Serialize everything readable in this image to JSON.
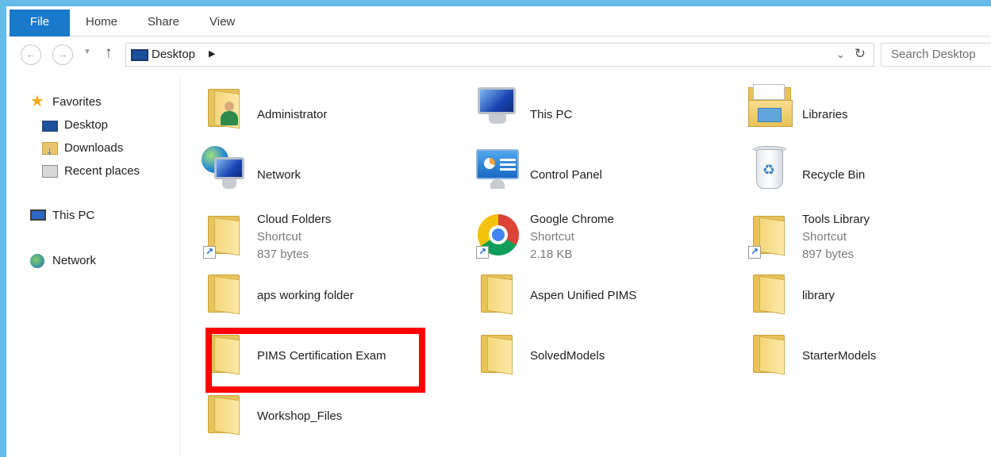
{
  "ribbon": {
    "tabs": [
      "File",
      "Home",
      "Share",
      "View"
    ]
  },
  "address": {
    "location": "Desktop",
    "search_placeholder": "Search Desktop"
  },
  "navigation": {
    "favorites": "Favorites",
    "desktop": "Desktop",
    "downloads": "Downloads",
    "recent_places": "Recent places",
    "this_pc": "This PC",
    "network": "Network"
  },
  "items": [
    {
      "name": "Administrator",
      "icon": "user-folder-icon"
    },
    {
      "name": "This PC",
      "icon": "computer-icon"
    },
    {
      "name": "Libraries",
      "icon": "libraries-icon"
    },
    {
      "name": "Network",
      "icon": "network-icon"
    },
    {
      "name": "Control Panel",
      "icon": "control-panel-icon"
    },
    {
      "name": "Recycle Bin",
      "icon": "recycle-bin-icon"
    },
    {
      "name": "Cloud Folders",
      "type": "Shortcut",
      "size": "837 bytes",
      "icon": "folder-shortcut-icon"
    },
    {
      "name": "Google Chrome",
      "type": "Shortcut",
      "size": "2.18 KB",
      "icon": "chrome-shortcut-icon"
    },
    {
      "name": "Tools Library",
      "type": "Shortcut",
      "size": "897 bytes",
      "icon": "folder-shortcut-icon"
    },
    {
      "name": "aps working folder",
      "icon": "folder-icon"
    },
    {
      "name": "Aspen Unified PIMS",
      "icon": "folder-icon"
    },
    {
      "name": "library",
      "icon": "folder-icon"
    },
    {
      "name": "PIMS Certification Exam",
      "icon": "folder-icon"
    },
    {
      "name": "SolvedModels",
      "icon": "folder-icon"
    },
    {
      "name": "StarterModels",
      "icon": "folder-icon"
    },
    {
      "name": "Workshop_Files",
      "icon": "folder-icon"
    }
  ],
  "colors": {
    "window_border": "#63bce8",
    "file_tab": "#1979ca",
    "highlight": "#ff0000"
  }
}
